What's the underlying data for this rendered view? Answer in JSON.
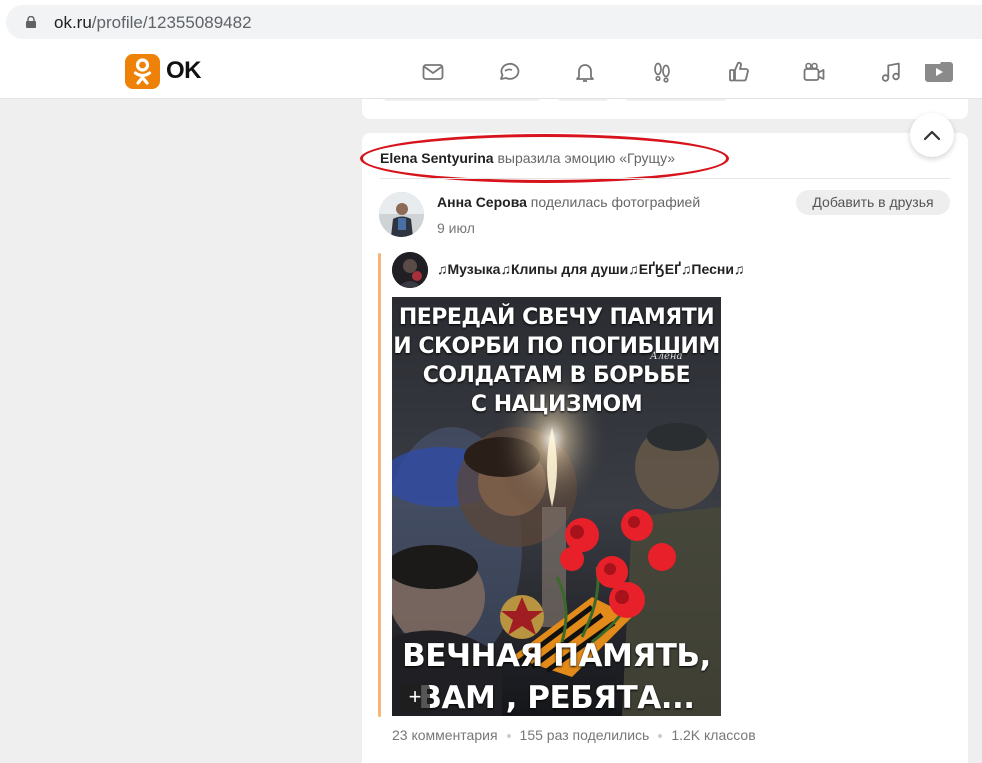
{
  "browser": {
    "url_host": "ok.ru",
    "url_path": "/profile/12355089482"
  },
  "header": {
    "logo_text": "OK",
    "nav_icons": [
      "mail-icon",
      "chat-icon",
      "bell-icon",
      "guests-icon",
      "like-icon",
      "video-camera-icon",
      "music-icon",
      "video-play-icon"
    ]
  },
  "colors": {
    "brand": "#ee8208",
    "highlight": "#d7141c"
  },
  "feed": {
    "event": {
      "user": "Elena Sentyurina",
      "action": "выразила эмоцию «Грущу»"
    },
    "post": {
      "author": "Анна Серова",
      "action": "поделилась фотографией",
      "date": "9 июл",
      "add_friend_label": "Добавить в друзья",
      "group_name": "♫Музыка♫Клипы для души♫ЕҐӃЕҐ♫Песни♫",
      "image_text_top": [
        "ПЕРЕДАЙ СВЕЧУ ПАМЯТИ",
        "И СКОРБИ ПО ПОГИБШИМ",
        "СОЛДАТАМ В БОРЬБЕ",
        "С НАЦИЗМОМ"
      ],
      "image_signature": "Алена",
      "image_text_bottom": [
        "ВЕЧНАЯ ПАМЯТЬ,",
        "ВАМ , РЕБЯТА..."
      ],
      "plus_label": "+",
      "stats": {
        "comments": "23 комментария",
        "shares": "155 раз поделились",
        "likes": "1.2K классов"
      }
    }
  }
}
